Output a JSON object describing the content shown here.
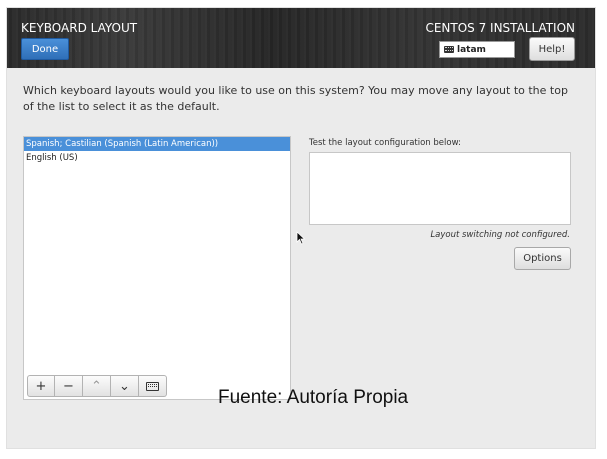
{
  "header": {
    "title": "KEYBOARD LAYOUT",
    "done_label": "Done",
    "installation_title": "CENTOS 7 INSTALLATION",
    "keyboard_indicator": "latam",
    "help_label": "Help!"
  },
  "main": {
    "question": "Which keyboard layouts would you like to use on this system?  You may move any layout to the top of the list to select it as the default.",
    "layouts": [
      {
        "label": "Spanish; Castilian (Spanish (Latin American))",
        "selected": true
      },
      {
        "label": "English (US)",
        "selected": false
      }
    ],
    "toolbar": {
      "add": "+",
      "remove": "−",
      "up": "⌃",
      "down": "⌄"
    },
    "test_label": "Test the layout configuration below:",
    "test_value": "",
    "switching_note": "Layout switching not configured.",
    "options_label": "Options"
  },
  "caption": "Fuente: Autoría Propia",
  "colors": {
    "header_bg": "#2d2d2d",
    "accent_blue": "#4a90d9",
    "panel_bg": "#ebebeb"
  }
}
